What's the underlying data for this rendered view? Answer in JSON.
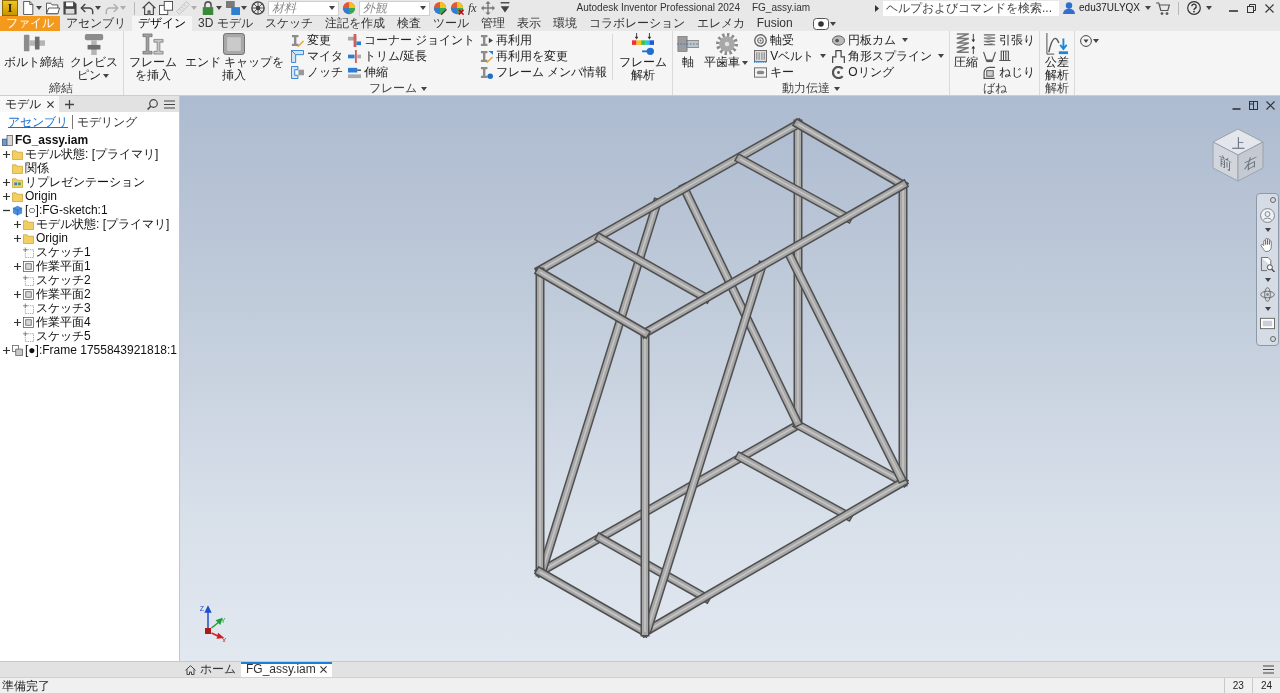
{
  "title_bar": {
    "logo": "I",
    "quick_access": [
      {
        "items": [
          {
            "kind": "button",
            "dropdown": true,
            "disabled": false
          },
          {
            "kind": "button",
            "dropdown": false,
            "disabled": false
          },
          {
            "kind": "button",
            "dropdown": false,
            "disabled": false
          },
          {
            "kind": "button",
            "dropdown": true,
            "disabled": false
          },
          {
            "kind": "button",
            "dropdown": true,
            "disabled": true
          }
        ]
      },
      {
        "items": [
          {
            "kind": "button",
            "dropdown": false,
            "disabled": false
          },
          {
            "kind": "button",
            "dropdown": false,
            "disabled": false
          },
          {
            "kind": "button",
            "dropdown": true,
            "disabled": true
          },
          {
            "kind": "button",
            "dropdown": true,
            "disabled": false
          },
          {
            "kind": "button",
            "dropdown": true,
            "disabled": false
          },
          {
            "kind": "button",
            "dropdown": false,
            "disabled": false
          },
          {
            "kind": "field",
            "placeholder": "材料",
            "dropdown": true,
            "disabled": false
          },
          {
            "kind": "button",
            "dropdown": false,
            "disabled": false
          },
          {
            "kind": "field",
            "placeholder": "外観",
            "dropdown": true,
            "disabled": false
          },
          {
            "kind": "button",
            "dropdown": false,
            "disabled": false
          },
          {
            "kind": "button",
            "dropdown": false,
            "disabled": false
          },
          {
            "kind": "text",
            "label": "fx",
            "dropdown": false,
            "disabled": false
          },
          {
            "kind": "button",
            "dropdown": false,
            "disabled": false
          },
          {
            "kind": "button",
            "dropdown": false,
            "disabled": false
          }
        ]
      }
    ],
    "title": "Autodesk Inventor Professional 2024",
    "document": "FG_assy.iam",
    "search": {
      "placeholder": "ヘルプおよびコマンドを検索..."
    },
    "user": "edu37ULYQX"
  },
  "ribbon_tabs": [
    {
      "label": "ファイル",
      "kind": "file",
      "selected": false
    },
    {
      "label": "アセンブリ",
      "kind": "tab",
      "selected": false
    },
    {
      "label": "デザイン",
      "kind": "tab",
      "selected": true
    },
    {
      "label": "3D モデル",
      "kind": "tab",
      "selected": false
    },
    {
      "label": "スケッチ",
      "kind": "tab",
      "selected": false
    },
    {
      "label": "注記を作成",
      "kind": "tab",
      "selected": false
    },
    {
      "label": "検査",
      "kind": "tab",
      "selected": false
    },
    {
      "label": "ツール",
      "kind": "tab",
      "selected": false
    },
    {
      "label": "管理",
      "kind": "tab",
      "selected": false
    },
    {
      "label": "表示",
      "kind": "tab",
      "selected": false
    },
    {
      "label": "環境",
      "kind": "tab",
      "selected": false
    },
    {
      "label": "コラボレーション",
      "kind": "tab",
      "selected": false
    },
    {
      "label": "エレメカ",
      "kind": "tab",
      "selected": false
    },
    {
      "label": "Fusion",
      "kind": "tab",
      "selected": false
    }
  ],
  "ribbon_panels": [
    {
      "title": "締結",
      "dropdown": false,
      "groups": [
        {
          "kind": "large",
          "items": [
            {
              "label": "ボルト締結",
              "dropdown": false
            },
            {
              "label": "クレビスピン",
              "dropdown": true
            }
          ]
        }
      ]
    },
    {
      "title": "フレーム",
      "dropdown": true,
      "groups": [
        {
          "kind": "large",
          "items": [
            {
              "label": "フレームを挿入",
              "dropdown": false
            },
            {
              "label": "エンド キャップを挿入",
              "dropdown": false
            }
          ]
        },
        {
          "kind": "small",
          "items": [
            {
              "label": "変更",
              "dropdown": false
            },
            {
              "label": "マイタ",
              "dropdown": false
            },
            {
              "label": "ノッチ",
              "dropdown": false
            }
          ]
        },
        {
          "kind": "small",
          "items": [
            {
              "label": "コーナー ジョイント",
              "dropdown": false
            },
            {
              "label": "トリム/延長",
              "dropdown": false
            },
            {
              "label": "伸縮",
              "dropdown": false
            }
          ]
        },
        {
          "kind": "small",
          "items": [
            {
              "label": "再利用",
              "dropdown": false
            },
            {
              "label": "再利用を変更",
              "dropdown": false
            },
            {
              "label": "フレーム メンバ情報",
              "dropdown": false
            }
          ]
        },
        {
          "kind": "separator"
        },
        {
          "kind": "large",
          "items": [
            {
              "label": "フレーム解析",
              "dropdown": false
            }
          ]
        }
      ]
    },
    {
      "title": "動力伝達",
      "dropdown": true,
      "groups": [
        {
          "kind": "large",
          "items": [
            {
              "label": "軸",
              "dropdown": false
            },
            {
              "label": "平歯車",
              "dropdown": true
            }
          ]
        },
        {
          "kind": "small",
          "items": [
            {
              "label": "軸受",
              "dropdown": false
            },
            {
              "label": "Vベルト",
              "dropdown": true
            },
            {
              "label": "キー",
              "dropdown": false
            }
          ]
        },
        {
          "kind": "small",
          "items": [
            {
              "label": "円板カム",
              "dropdown": true
            },
            {
              "label": "角形スプライン",
              "dropdown": true
            },
            {
              "label": "Oリング",
              "dropdown": false
            }
          ]
        }
      ]
    },
    {
      "title": "ばね",
      "dropdown": false,
      "groups": [
        {
          "kind": "large",
          "items": [
            {
              "label": "圧縮",
              "dropdown": false
            }
          ]
        },
        {
          "kind": "small",
          "items": [
            {
              "label": "引張り",
              "dropdown": false
            },
            {
              "label": "皿",
              "dropdown": false
            },
            {
              "label": "ねじり",
              "dropdown": false
            }
          ]
        }
      ]
    },
    {
      "title": "解析",
      "dropdown": false,
      "groups": [
        {
          "kind": "large",
          "items": [
            {
              "label": "公差解析",
              "dropdown": false
            }
          ]
        }
      ]
    }
  ],
  "browser": {
    "tabs": [
      {
        "label": "モデル",
        "selected": true
      }
    ],
    "modes": [
      {
        "label": "アセンブリ",
        "selected": true
      },
      {
        "label": "モデリング",
        "selected": false
      }
    ],
    "tree": [
      {
        "label": "FG_assy.iam",
        "kind": "assembly",
        "children": [
          {
            "label": "モデル状態: [プライマリ]",
            "kind": "folder",
            "expanded": false
          },
          {
            "label": "関係",
            "kind": "folder"
          },
          {
            "label": "リプレゼンテーション",
            "kind": "representations",
            "expanded": false
          },
          {
            "label": "Origin",
            "kind": "folder",
            "expanded": false
          },
          {
            "label": "[○]:FG-sketch:1",
            "kind": "part",
            "expanded": true,
            "children": [
              {
                "label": "モデル状態: [プライマリ]",
                "kind": "folder",
                "expanded": false
              },
              {
                "label": "Origin",
                "kind": "folder",
                "expanded": false
              },
              {
                "label": "スケッチ1",
                "kind": "sketch"
              },
              {
                "label": "作業平面1",
                "kind": "work-plane",
                "expanded": false
              },
              {
                "label": "スケッチ2",
                "kind": "sketch"
              },
              {
                "label": "作業平面2",
                "kind": "work-plane",
                "expanded": false
              },
              {
                "label": "スケッチ3",
                "kind": "sketch"
              },
              {
                "label": "作業平面4",
                "kind": "work-plane",
                "expanded": false
              },
              {
                "label": "スケッチ5",
                "kind": "sketch"
              }
            ]
          },
          {
            "label": "[●]:Frame 1755843921818:1",
            "kind": "frame",
            "expanded": false
          }
        ]
      }
    ]
  },
  "viewport": {
    "view_cube": {
      "faces": [
        "上",
        "前",
        "右"
      ]
    },
    "axes": [
      {
        "label": "Z",
        "color": "#1f4fd0"
      },
      {
        "label": "Y",
        "color": "#1e9e36"
      },
      {
        "label": "X",
        "color": "#d21f1f"
      }
    ]
  },
  "document_tabs": [
    {
      "label": "ホーム",
      "kind": "home",
      "selected": false
    },
    {
      "label": "FG_assy.iam",
      "kind": "document",
      "selected": true
    }
  ],
  "status_bar": {
    "message": "準備完了",
    "counts": [
      "23",
      "24"
    ]
  }
}
